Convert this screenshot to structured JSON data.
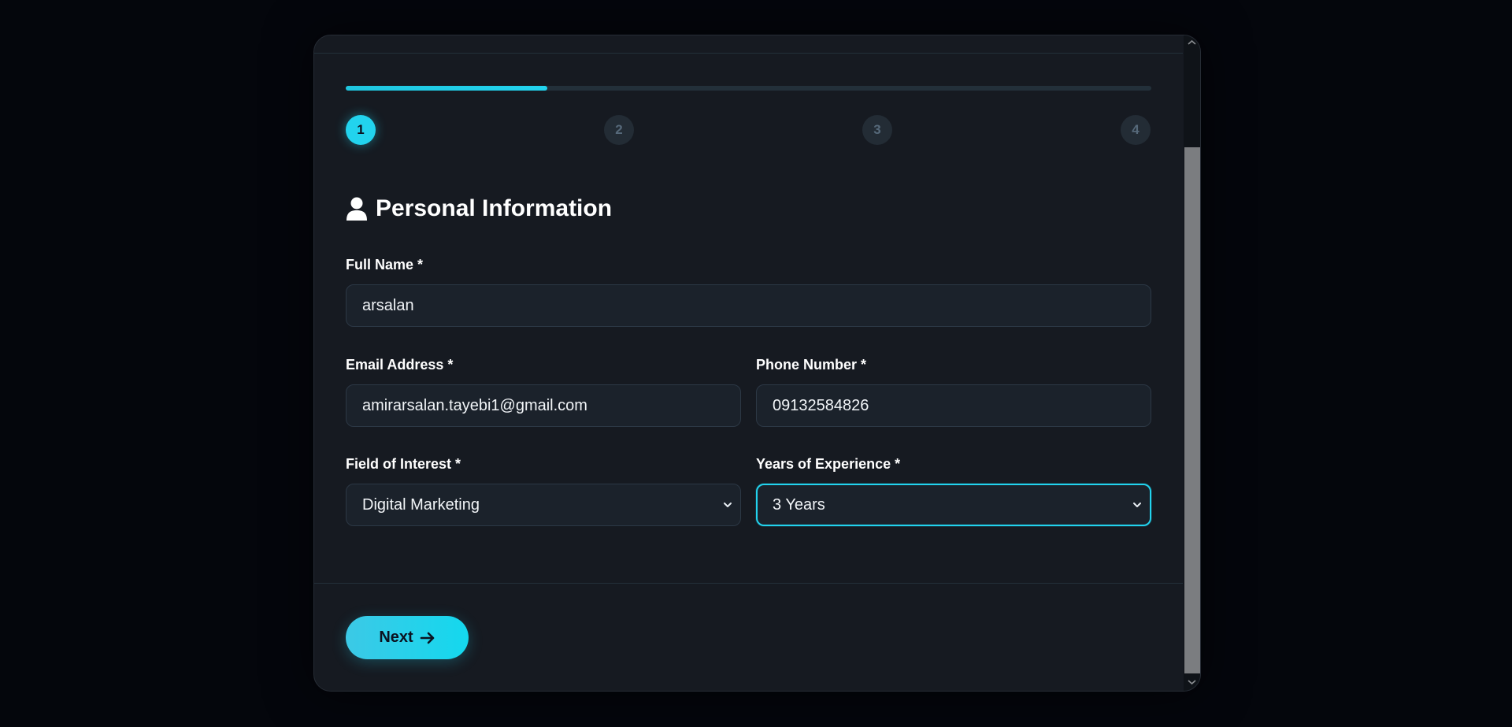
{
  "progress": {
    "fraction": 0.25,
    "steps": [
      "1",
      "2",
      "3",
      "4"
    ],
    "active_step": 1
  },
  "section": {
    "icon": "user-icon",
    "title": "Personal Information"
  },
  "fields": {
    "full_name": {
      "label": "Full Name *",
      "value": "arsalan"
    },
    "email": {
      "label": "Email Address *",
      "value": "amirarsalan.tayebi1@gmail.com"
    },
    "phone": {
      "label": "Phone Number *",
      "value": "09132584826"
    },
    "field_of_interest": {
      "label": "Field of Interest *",
      "value": "Digital Marketing"
    },
    "years_experience": {
      "label": "Years of Experience *",
      "value": "3 Years"
    }
  },
  "footer": {
    "next_label": "Next",
    "next_icon": "arrow-right-icon"
  },
  "colors": {
    "accent": "#22d3ee",
    "panel": "#161a21",
    "input_bg": "#1b222b"
  }
}
